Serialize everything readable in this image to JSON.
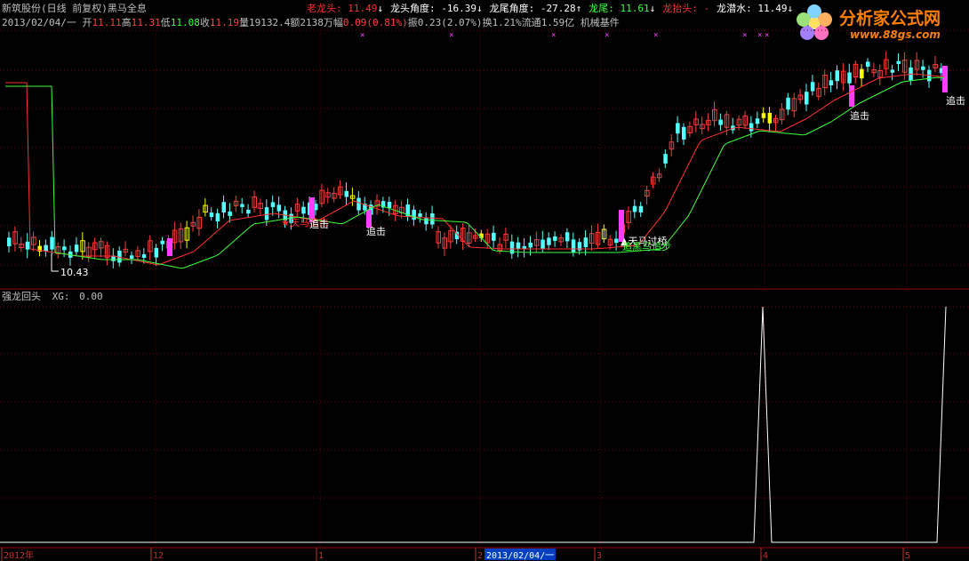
{
  "header": {
    "name": "新筑股份(日线 前复权)",
    "formula": "黑马全息",
    "date": "2013/02/04/一",
    "quote": [
      {
        "label": "开",
        "value": "11.11",
        "color": "#ff4040"
      },
      {
        "label": "高",
        "value": "11.31",
        "color": "#ff4040"
      },
      {
        "label": "低",
        "value": "11.08",
        "color": "#3cff3c"
      },
      {
        "label": "收",
        "value": "11.19",
        "color": "#ff4040"
      },
      {
        "label": "量",
        "value": "19132.4",
        "color": "#c0c0c0"
      },
      {
        "label": "额",
        "value": "2138万",
        "color": "#c0c0c0"
      },
      {
        "label": "幅",
        "value": "0.09(0.81%)",
        "color": "#ff4040"
      },
      {
        "label": "振",
        "value": "0.23(2.07%)",
        "color": "#c0c0c0"
      },
      {
        "label": "换",
        "value": "1.21%",
        "color": "#c0c0c0"
      },
      {
        "label": "流通",
        "value": "1.59亿",
        "color": "#c0c0c0"
      }
    ],
    "sector": "机械基件"
  },
  "indicators": [
    {
      "label": "老龙头:",
      "value": "11.49",
      "arrow": "↓",
      "label_color": "#ff3030",
      "value_color": "#ff3030"
    },
    {
      "label": "龙头角度:",
      "value": "-16.39",
      "arrow": "↓",
      "label_color": "#ffffff",
      "value_color": "#ffffff"
    },
    {
      "label": "龙尾角度:",
      "value": "-27.28",
      "arrow": "↑",
      "label_color": "#ffffff",
      "value_color": "#ffffff"
    },
    {
      "label": "龙尾:",
      "value": "11.61",
      "arrow": "↓",
      "label_color": "#3cff3c",
      "value_color": "#3cff3c"
    },
    {
      "label": "龙抬头:",
      "value": "-",
      "arrow": "",
      "label_color": "#ff3030",
      "value_color": "#ff3030"
    },
    {
      "label": "龙潜水:",
      "value": "11.49",
      "arrow": "↓",
      "label_color": "#ffffff",
      "value_color": "#ffffff"
    }
  ],
  "logo": {
    "title": "分析家公式网",
    "url": "www.88gs.com"
  },
  "annotations": {
    "low_price": "10.43",
    "chase1": "追击",
    "chase2": "追击",
    "chase3": "追击",
    "chase4": "追击",
    "signal_left": "★庆马追击",
    "signal_mid": "▲天马过桥",
    "signal_mid2": "追黑马追步"
  },
  "sub_panel": {
    "title": "强龙回头",
    "xg_label": "XG:",
    "xg_value": "0.00"
  },
  "x_axis": {
    "labels": [
      "2012年",
      "12",
      "1",
      "2",
      "3",
      "4",
      "5"
    ],
    "cursor_date": "2013/02/04/一"
  },
  "colors": {
    "up": "#ff3c3c",
    "down": "#54ffff",
    "ma1": "#ff3030",
    "ma2": "#3cff3c",
    "signal": "#ff3cff",
    "flat": "#ffff00"
  }
}
